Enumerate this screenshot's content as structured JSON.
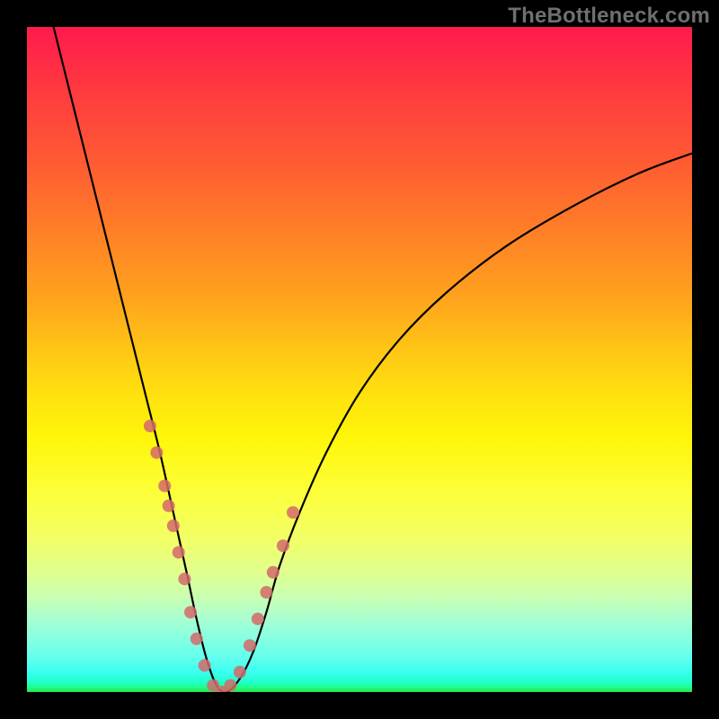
{
  "watermark": "TheBottleneck.com",
  "chart_data": {
    "type": "line",
    "title": "",
    "xlabel": "",
    "ylabel": "",
    "xlim": [
      0,
      100
    ],
    "ylim": [
      0,
      100
    ],
    "grid": false,
    "legend": false,
    "series": [
      {
        "name": "bottleneck-curve",
        "color": "#000000",
        "x": [
          4,
          6,
          8,
          10,
          12,
          14,
          16,
          18,
          20,
          22,
          24,
          25.5,
          27,
          28.5,
          30,
          32,
          34,
          36,
          38,
          41,
          45,
          50,
          56,
          63,
          72,
          82,
          92,
          100
        ],
        "y": [
          100,
          92,
          84,
          76,
          68,
          60,
          52,
          44,
          36,
          27,
          18,
          11,
          5,
          1,
          0,
          2,
          6,
          12,
          19,
          27,
          36,
          45,
          53,
          60,
          67,
          73,
          78,
          81
        ]
      }
    ],
    "markers": {
      "name": "highlight-points",
      "color": "#d46a6a",
      "radius_px": 7,
      "x": [
        18.5,
        19.5,
        20.7,
        21.3,
        22.0,
        22.8,
        23.7,
        24.6,
        25.5,
        26.7,
        28.0,
        29.3,
        30.6,
        32.0,
        33.5,
        34.7,
        36.0,
        37.0,
        38.5,
        40.0
      ],
      "y": [
        40,
        36,
        31,
        28,
        25,
        21,
        17,
        12,
        8,
        4,
        1,
        0,
        1,
        3,
        7,
        11,
        15,
        18,
        22,
        27
      ]
    },
    "background": {
      "type": "vertical-gradient",
      "stops": [
        {
          "pos": 0.0,
          "color": "#ff1a4c"
        },
        {
          "pos": 0.3,
          "color": "#ff7d27"
        },
        {
          "pos": 0.55,
          "color": "#ffe00f"
        },
        {
          "pos": 0.8,
          "color": "#e0ff8f"
        },
        {
          "pos": 0.95,
          "color": "#60ffee"
        },
        {
          "pos": 1.0,
          "color": "#28e24a"
        }
      ]
    }
  }
}
